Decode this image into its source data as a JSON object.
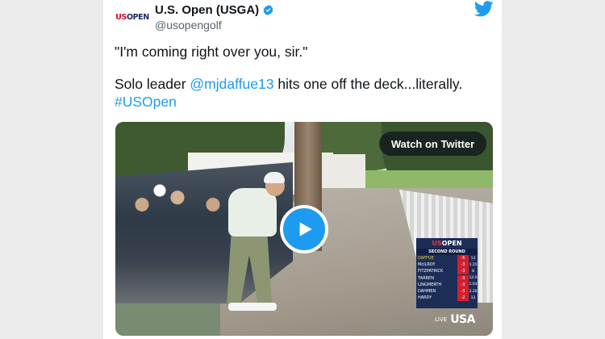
{
  "account": {
    "display_name": "U.S. Open (USGA)",
    "handle": "@usopengolf",
    "avatar_text_us": "US",
    "avatar_text_open": "OPEN",
    "verified_icon": "verified-badge-icon",
    "brand_icon": "twitter-bird-icon"
  },
  "tweet": {
    "line1": "\"I'm coming right over you, sir.\"",
    "line2_prefix": "Solo leader ",
    "mention": "@mjdaffue13",
    "line2_suffix": " hits one off the deck...literally.",
    "hashtag": "#USOpen"
  },
  "video": {
    "watch_button": "Watch on Twitter",
    "play_icon": "play-icon",
    "scoreboard": {
      "logo_us": "US",
      "logo_open": "OPEN",
      "round": "SECOND ROUND",
      "players": [
        {
          "name": "DAFFUE",
          "score": "-5",
          "thru": "13"
        },
        {
          "name": "McILROY",
          "score": "-3",
          "thru": "1:25"
        },
        {
          "name": "FITZPATRICK",
          "score": "-3",
          "thru": "8"
        },
        {
          "name": "TARREN",
          "score": "-3",
          "thru": "12:0"
        },
        {
          "name": "LINGMERTH",
          "score": "-3",
          "thru": "1:03"
        },
        {
          "name": "DAHMEN",
          "score": "-3",
          "thru": "2:20"
        },
        {
          "name": "HARDY",
          "score": "-2",
          "thru": "12"
        }
      ]
    },
    "network": {
      "live": "LIVE",
      "logo": "USA"
    }
  },
  "colors": {
    "link": "#1d9bf0",
    "play": "#1d9bf0",
    "scoreboard": "#1c2d58",
    "score_bg": "#d1202d"
  }
}
